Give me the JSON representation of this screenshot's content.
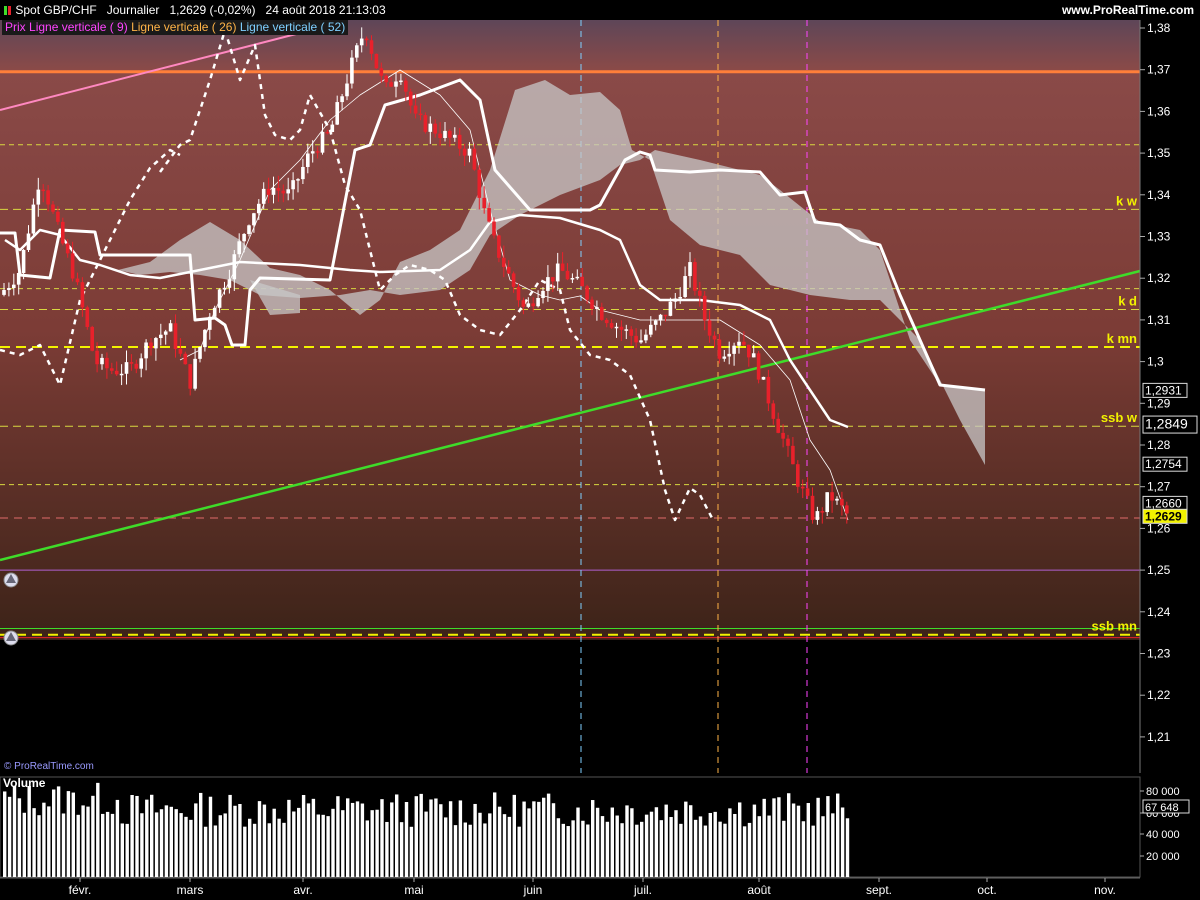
{
  "header": {
    "instrument": "Spot GBP/CHF",
    "period": "Journalier",
    "last": "1,2629 (-0,02%)",
    "datetime": "24 août 2018 21:13:03",
    "site": "www.ProRealTime.com",
    "watermark": "© ProRealTime.com"
  },
  "legend": [
    {
      "label": "Prix",
      "color": "#ff44ff"
    },
    {
      "label": "Ligne verticale ( 9)",
      "color": "#ff44ff"
    },
    {
      "label": "Ligne verticale ( 26)",
      "color": "#ffb347"
    },
    {
      "label": "Ligne verticale ( 52)",
      "color": "#7fd0ff"
    }
  ],
  "colors": {
    "up": "#ffffff",
    "down": "#e8212b",
    "trendline": "#3fdc2a",
    "resistance": "#ff7f3a",
    "cloud": "#c8c8c8",
    "level": "#e6e600"
  },
  "chart_data": [
    {
      "type": "candlestick",
      "title": "",
      "y_axis": {
        "min": 1.2,
        "max": 1.38,
        "ticks": [
          "1,38",
          "1,37",
          "1,36",
          "1,35",
          "1,34",
          "1,33",
          "1,32",
          "1,31",
          "1,3",
          "1,29",
          "1,28",
          "1,27",
          "1,26",
          "1,25",
          "1,24",
          "1,23",
          "1,22",
          "1,21"
        ]
      },
      "x_axis": {
        "ticks": [
          "févr.",
          "mars",
          "avr.",
          "mai",
          "juin",
          "juil.",
          "août",
          "sept.",
          "oct.",
          "nov."
        ]
      },
      "last_close": 1.2629,
      "level_labels": [
        {
          "label": "k w",
          "value": 1.3365
        },
        {
          "label": "k d",
          "value": 1.3125
        },
        {
          "label": "k mn",
          "value": 1.3035
        },
        {
          "label": "ssb w",
          "value": 1.2845
        },
        {
          "label": "ssb mn",
          "value": 1.2345
        }
      ],
      "price_tags": [
        {
          "text": "1,2931",
          "value": 1.2931
        },
        {
          "text": "1,2849",
          "value": 1.2849
        },
        {
          "text": "1,2754",
          "value": 1.2754
        },
        {
          "text": "1,2660",
          "value": 1.266
        },
        {
          "text": "1,2629",
          "value": 1.2629
        }
      ]
    },
    {
      "type": "bar",
      "title": "Volume",
      "y_axis": {
        "ticks": [
          "80 000",
          "60 000",
          "40 000",
          "20 000"
        ]
      },
      "last_value": "67 648"
    }
  ]
}
